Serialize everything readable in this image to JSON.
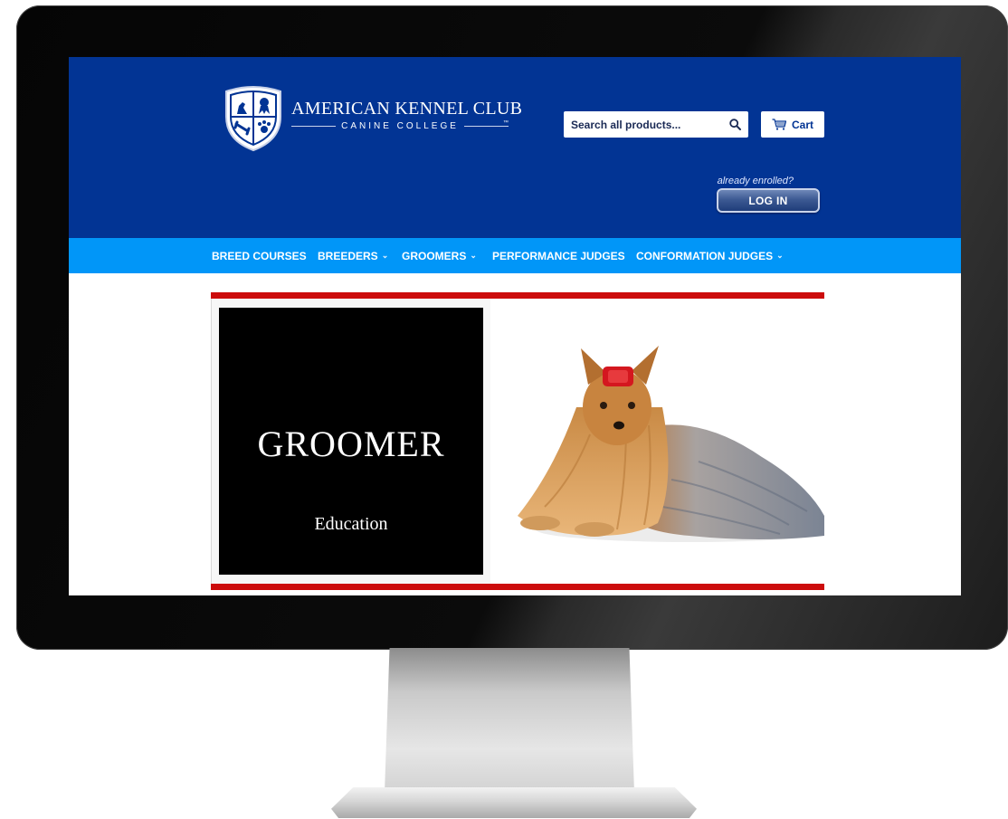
{
  "brand": {
    "title": "AMERICAN KENNEL CLUB",
    "subtitle": "CANINE COLLEGE",
    "trademark": "™"
  },
  "header": {
    "search_placeholder": "Search all products...",
    "cart_label": "Cart",
    "enrolled_prompt": "already enrolled?",
    "login_label": "LOG IN"
  },
  "nav": {
    "items": [
      {
        "label": "BREED COURSES",
        "has_dropdown": false
      },
      {
        "label": "BREEDERS",
        "has_dropdown": true
      },
      {
        "label": "GROOMERS",
        "has_dropdown": true
      },
      {
        "label": "PERFORMANCE JUDGES",
        "has_dropdown": false
      },
      {
        "label": "CONFORMATION JUDGES",
        "has_dropdown": true
      }
    ],
    "caret": "⌄"
  },
  "banner": {
    "title": "GROOMER",
    "subtitle": "Education",
    "image": "yorkshire-terrier-photo"
  },
  "colors": {
    "header_bg": "#023494",
    "nav_bg": "#0196f8",
    "banner_accent": "#cc0c0c"
  },
  "icons": {
    "search": "search-icon",
    "cart": "cart-icon",
    "logo": "akc-shield-logo"
  }
}
